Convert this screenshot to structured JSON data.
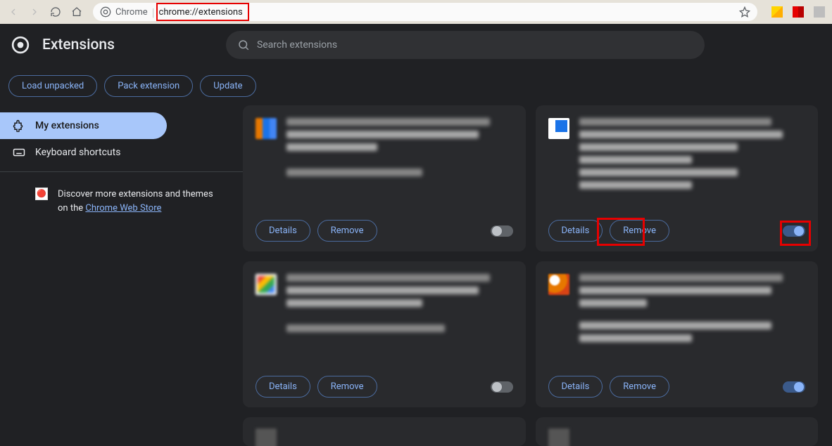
{
  "browser": {
    "url": "chrome://extensions",
    "url_label": "Chrome"
  },
  "header": {
    "title": "Extensions",
    "search_placeholder": "Search extensions"
  },
  "actions": {
    "load_unpacked": "Load unpacked",
    "pack_extension": "Pack extension",
    "update": "Update"
  },
  "sidebar": {
    "my_extensions": "My extensions",
    "keyboard_shortcuts": "Keyboard shortcuts",
    "discover_text": "Discover more extensions and themes on the ",
    "discover_link": "Chrome Web Store"
  },
  "card": {
    "details": "Details",
    "remove": "Remove"
  },
  "extensions": [
    {
      "enabled": false
    },
    {
      "enabled": true
    },
    {
      "enabled": false
    },
    {
      "enabled": true
    }
  ]
}
